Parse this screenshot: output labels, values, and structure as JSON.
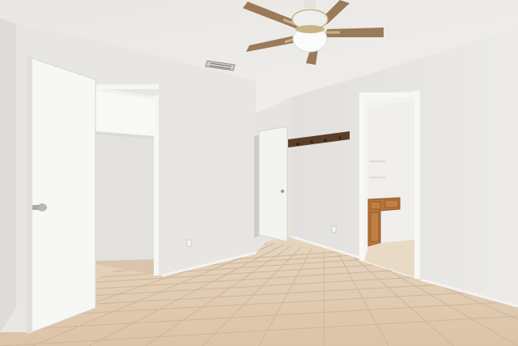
{
  "scene": {
    "kind": "photo",
    "subject": "empty-bedroom-interior",
    "palette": {
      "ceiling": "#eeece9",
      "wall_left": "#e8e6e3",
      "wall_back": "#ebe9e6",
      "wall_right": "#e6e4e1",
      "floor_tile": "#e3cfb6",
      "grout": "#cdb69c",
      "door": "#f7f7f5",
      "cabinet_wood": "#b8743a",
      "fan_blade": "#9a7a58",
      "fan_brass": "#c9b48a",
      "coat_rack": "#5a3e28"
    }
  }
}
